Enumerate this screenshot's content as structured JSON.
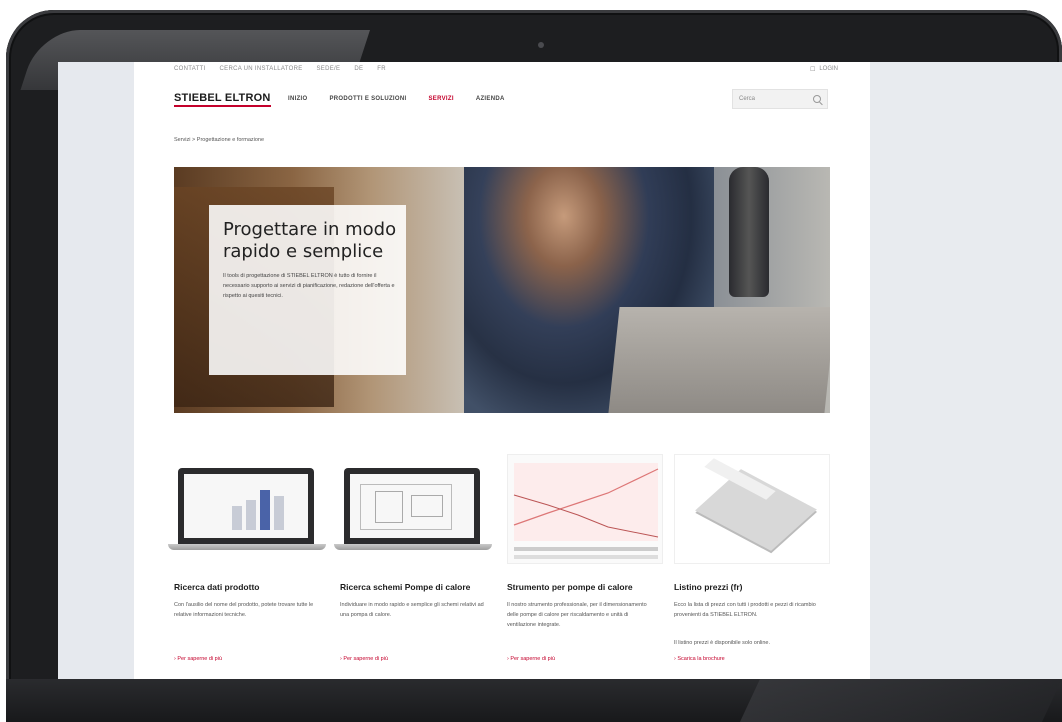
{
  "topbar": {
    "links": [
      "CONTATTI",
      "CERCA UN INSTALLATORE",
      "SEDE/E",
      "DE",
      "FR"
    ],
    "login": "LOGIN"
  },
  "header": {
    "logo": "STIEBEL ELTRON",
    "nav": [
      "INIZIO",
      "PRODOTTI E SOLUZIONI",
      "SERVIZI",
      "AZIENDA"
    ],
    "active_nav": "SERVIZI",
    "search_placeholder": "Cerca"
  },
  "breadcrumb": "Servizi  >  Progettazione e formazione",
  "hero": {
    "title": "Progettare in modo rapido e semplice",
    "text": "Il tools di progettazione di STIEBEL ELTRON è tutto di fornire il necessario supporto ai servizi di pianificazione, redazione dell'offerta e rispetto ai quesiti tecnici."
  },
  "cards": [
    {
      "title": "Ricerca dati prodotto",
      "description": "Con l'ausilio del nome del prodotto, potete trovare tutte le relative informazioni tecniche.",
      "description2": "",
      "link": "›  Per saperne di più"
    },
    {
      "title": "Ricerca schemi Pompe di calore",
      "description": "Individuare in modo rapido e semplice gli schemi relativi ad una pompa di calore.",
      "description2": "",
      "link": "›  Per saperne di più"
    },
    {
      "title": "Strumento per pompe di calore",
      "description": "Il nostro strumento professionale, per il dimensionamento delle pompe di calore per riscaldamento e unità di ventilazione integrate.",
      "description2": "",
      "link": "›  Per saperne di più"
    },
    {
      "title": "Listino prezzi (fr)",
      "description": "Ecco la lista di prezzi con tutti i prodotti e pezzi di ricambio provenienti da STIEBEL ELTRON.",
      "description2": "Il listino prezzi è disponibile solo online.",
      "link": "›  Scarica la brochure"
    }
  ],
  "colors": {
    "accent": "#c4002b",
    "bezel": "#1d1e20"
  }
}
